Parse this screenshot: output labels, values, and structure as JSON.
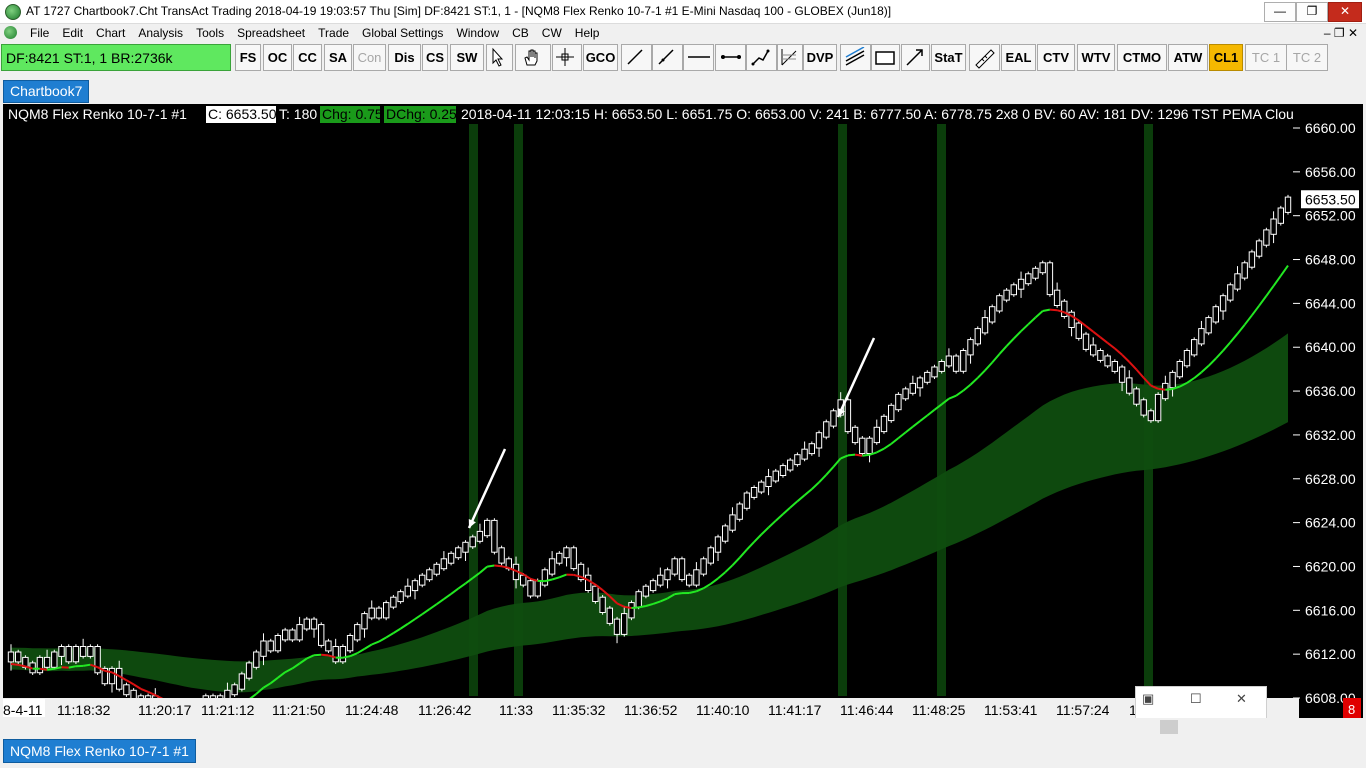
{
  "window": {
    "title": "AT 1727 Chartbook7.Cht  TransAct Trading 2018-04-19  19:03:57 Thu [Sim]  DF:8421  ST:1, 1 - [NQM8  Flex Renko 10-7-1  #1  E-Mini Nasdaq 100 - GLOBEX (Jun18)]",
    "minimize": "—",
    "restore": "❐",
    "close": "✕"
  },
  "menu": {
    "items": [
      "File",
      "Edit",
      "Chart",
      "Analysis",
      "Tools",
      "Spreadsheet",
      "Trade",
      "Global Settings",
      "Window",
      "CB",
      "CW",
      "Help"
    ],
    "right_controls": "–  ❐  ✕"
  },
  "toolbar": {
    "status": "DF:8421  ST:1, 1  BR:2736k",
    "buttons": [
      {
        "label": "FS"
      },
      {
        "label": "OC"
      },
      {
        "label": "CC"
      },
      {
        "label": "SA"
      },
      {
        "label": "Con",
        "disabled": true
      },
      {
        "label": "Dis"
      },
      {
        "label": "CS"
      },
      {
        "label": "SW"
      },
      {
        "icon": "cursor-icon"
      },
      {
        "icon": "hand-icon"
      },
      {
        "icon": "crosshair-icon"
      },
      {
        "label": "GCO"
      },
      {
        "icon": "line-icon"
      },
      {
        "icon": "ray-icon"
      },
      {
        "icon": "hline-icon"
      },
      {
        "icon": "segment-icon"
      },
      {
        "icon": "multiline-icon"
      },
      {
        "icon": "fib-icon"
      },
      {
        "label": "DVP"
      },
      {
        "icon": "channel-icon"
      },
      {
        "icon": "rectangle-icon"
      },
      {
        "icon": "arrow-icon"
      },
      {
        "label": "StaT"
      },
      {
        "icon": "ruler-icon"
      },
      {
        "label": "EAL"
      },
      {
        "label": "CTV"
      },
      {
        "label": "WTV"
      },
      {
        "label": "CTMO"
      },
      {
        "label": "ATW"
      },
      {
        "label": "CL1",
        "highlight": "#f5b800"
      },
      {
        "label": "TC 1",
        "disabled": true
      },
      {
        "label": "TC 2",
        "disabled": true
      }
    ]
  },
  "tabs": {
    "chartbook": "Chartbook7",
    "bottom": "NQM8  Flex Renko 10-7-1  #1"
  },
  "chart": {
    "header_text": "NQM8  Flex Renko 10-7-1  #1",
    "c_field": "C: 6653.50",
    "t_field": "T: 180",
    "chg_field": "Chg: 0.75",
    "dchg_field": "DChg: 0.25",
    "detail_text": "2018-04-11 12:03:15 H: 6653.50 L: 6651.75 O: 6653.00 V: 241 B: 6777.50 A: 6778.75 2x8 0 BV: 60 AV: 181 DV: 1296 TST PEMA Clou",
    "current_price": "6653.50",
    "corner_badge": "8",
    "colors": {
      "background": "#000000",
      "band": "#0f4d0f",
      "highlight_column": "#0b3d0b",
      "ma_up": "#22e822",
      "ma_down": "#dd1111",
      "candle": "#ffffff",
      "chg_bg": "#1a9a1a"
    }
  },
  "chart_data": {
    "type": "candlestick",
    "ylim": [
      6606,
      6662
    ],
    "y_ticks": [
      "6660.00",
      "6656.00",
      "6652.00",
      "6648.00",
      "6644.00",
      "6640.00",
      "6636.00",
      "6632.00",
      "6628.00",
      "6624.00",
      "6620.00",
      "6616.00",
      "6612.00",
      "6608.00"
    ],
    "x_labels": [
      "8-4-11",
      "11:18:32",
      "11:20:17",
      "11:21:12",
      "11:21:50",
      "11:24:48",
      "11:26:42",
      "11:33",
      "11:35:32",
      "11:36:52",
      "11:40:10",
      "11:41:17",
      "11:46:44",
      "11:48:25",
      "11:53:41",
      "11:57:24",
      "1"
    ],
    "closes": [
      6612,
      6611.5,
      6611,
      6610.5,
      6611.5,
      6611,
      6612,
      6612.5,
      6611.5,
      6612.5,
      6612,
      6612.5,
      6610.5,
      6609.5,
      6610.5,
      6609,
      6608.5,
      6608,
      6607.5,
      6608,
      6607.5,
      6607,
      6606.5,
      6607,
      6606.5,
      6607,
      6607.5,
      6608,
      6607.5,
      6608,
      6608.5,
      6609,
      6610,
      6611,
      6612,
      6613,
      6612.5,
      6613.5,
      6614,
      6613.5,
      6614.5,
      6615,
      6614.5,
      6613,
      6612.5,
      6611.5,
      6612.5,
      6613.5,
      6614.5,
      6615.5,
      6616,
      6615.5,
      6616.5,
      6617,
      6617.5,
      6618,
      6618.5,
      6619,
      6619.5,
      6620,
      6620.5,
      6621,
      6621.5,
      6622,
      6622.5,
      6623,
      6624,
      6621.5,
      6620.5,
      6620,
      6619,
      6618.5,
      6617.5,
      6618.5,
      6619.5,
      6620.5,
      6621,
      6621.5,
      6620,
      6619,
      6618,
      6617,
      6616,
      6615,
      6614,
      6615.5,
      6616.5,
      6617.5,
      6618,
      6618.5,
      6619,
      6619.5,
      6620.5,
      6619,
      6618.5,
      6619.5,
      6620.5,
      6621.5,
      6622.5,
      6623.5,
      6624.5,
      6625.5,
      6626.5,
      6627,
      6627.5,
      6628,
      6628.5,
      6629,
      6629.5,
      6630,
      6630.5,
      6631,
      6632,
      6633,
      6634,
      6635,
      6632.5,
      6631.5,
      6630.5,
      6631.5,
      6632.5,
      6633.5,
      6634.5,
      6635.5,
      6636,
      6636.5,
      6637,
      6637.5,
      6638,
      6638.5,
      6639,
      6638,
      6639.5,
      6640.5,
      6641.5,
      6642.5,
      6643.5,
      6644.5,
      6645,
      6645.5,
      6646,
      6646.5,
      6647,
      6647.5,
      6645,
      6644,
      6643,
      6642,
      6641,
      6640,
      6639.5,
      6639,
      6638.5,
      6638,
      6637,
      6636,
      6635,
      6634,
      6633.5,
      6635.5,
      6636.5,
      6637.5,
      6638.5,
      6639.5,
      6640.5,
      6641.5,
      6642.5,
      6643.5,
      6644.5,
      6645.5,
      6646.5,
      6647.5,
      6648.5,
      6649.5,
      6650.5,
      6651.5,
      6652.5,
      6653.5
    ]
  }
}
